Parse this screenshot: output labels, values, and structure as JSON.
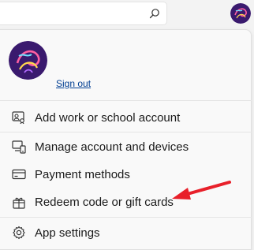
{
  "search": {
    "icon": "search-icon"
  },
  "account": {
    "avatar_icon": "profile-avatar",
    "sign_out_label": "Sign out"
  },
  "menu": {
    "items": [
      {
        "label": "Add work or school account",
        "icon": "person-card-icon"
      },
      {
        "label": "Manage account and devices",
        "icon": "devices-icon"
      },
      {
        "label": "Payment methods",
        "icon": "credit-card-icon"
      },
      {
        "label": "Redeem code or gift cards",
        "icon": "gift-icon"
      },
      {
        "label": "App settings",
        "icon": "gear-icon"
      }
    ]
  },
  "annotation": {
    "arrow_color": "#e8202a"
  },
  "colors": {
    "link": "#003e92",
    "avatar_bg": "#3a1a6e"
  }
}
